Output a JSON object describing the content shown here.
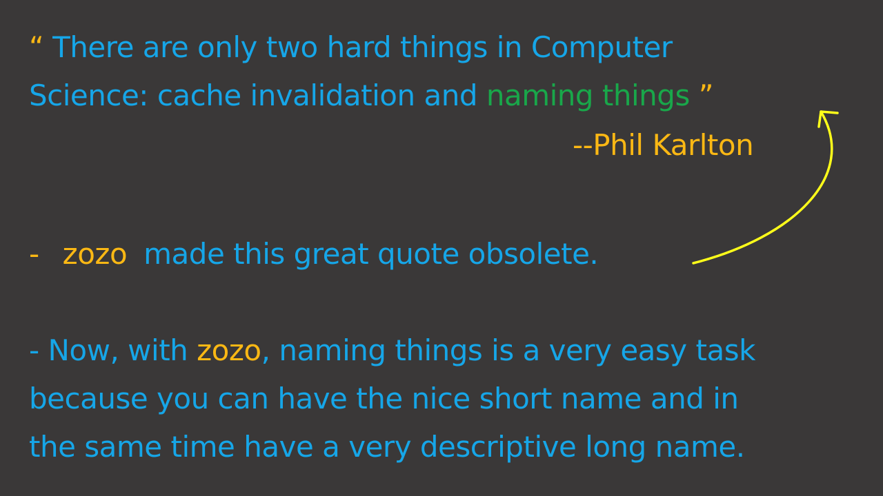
{
  "quote": {
    "open_mark": "“",
    "line1_text": " There are only two hard things in Computer",
    "line2_text": "Science: cache invalidation and ",
    "highlight": "naming things",
    "close_mark": " ”",
    "attribution": "--Phil Karlton"
  },
  "obsolete_line": {
    "bullet": "-",
    "brand": "zozo",
    "text": "made this great quote obsolete."
  },
  "paragraph": {
    "prefix": "- Now, with ",
    "brand": "zozo",
    "line1_rest": ", naming things is a very easy task",
    "line2": "because you can have the nice short name and in",
    "line3": "the same time have a very descriptive long name."
  },
  "colors": {
    "background": "#3a3838",
    "text_blue": "#16a6e8",
    "accent_orange": "#fbb814",
    "accent_green": "#19a74a",
    "arrow_yellow": "#ffff1a"
  },
  "icons": {
    "arrow": "curved-arrow-icon"
  }
}
